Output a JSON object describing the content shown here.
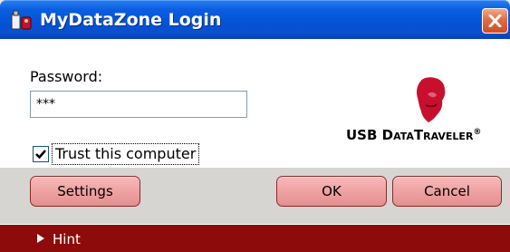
{
  "window": {
    "title": "MyDataZone Login",
    "icon": "usb-drive-icon",
    "close_icon": "close-icon",
    "accent_color": "#0552d6",
    "close_color": "#e06b45"
  },
  "form": {
    "password_label": "Password:",
    "password_value": "***",
    "trust_label": "Trust this computer",
    "trust_checked": true
  },
  "brand": {
    "logo_icon": "kingston-head-logo",
    "name_part1": "USB D",
    "name_part2": "ATA",
    "name_part3": "T",
    "name_part4": "RAVELER",
    "registered": "®",
    "logo_color": "#c8102e"
  },
  "buttons": {
    "settings": "Settings",
    "ok": "OK",
    "cancel": "Cancel",
    "button_color": "#eea0a0"
  },
  "hint": {
    "label": "Hint",
    "arrow_icon": "expand-arrow-icon",
    "bar_color": "#8e0b0b"
  }
}
